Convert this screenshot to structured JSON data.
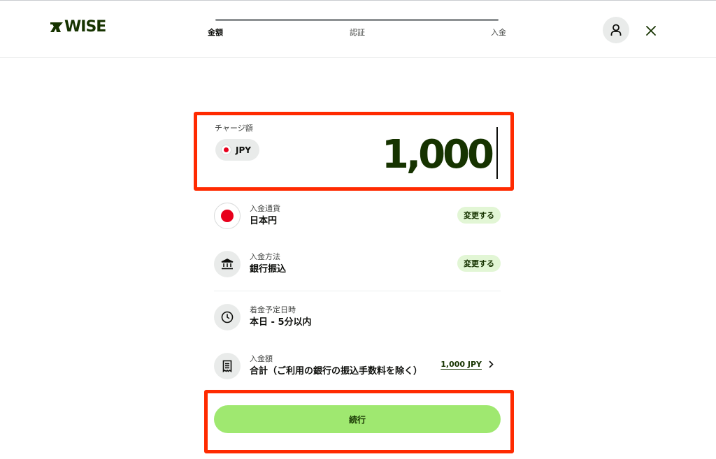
{
  "brand": {
    "logo_text": "WISE",
    "color": "#163300"
  },
  "stepper": {
    "steps": [
      {
        "label": "金額"
      },
      {
        "label": "認証"
      },
      {
        "label": "入金"
      }
    ]
  },
  "header": {
    "account_icon": "person-icon",
    "close_icon": "close-icon"
  },
  "amount": {
    "label": "チャージ額",
    "currency_code": "JPY",
    "value": "1,000"
  },
  "details": {
    "currency": {
      "label": "入金通貨",
      "value": "日本円",
      "action": "変更する",
      "icon": "japan-flag-icon"
    },
    "method": {
      "label": "入金方法",
      "value": "銀行振込",
      "action": "変更する",
      "icon": "bank-icon"
    },
    "arrival": {
      "label": "着金予定日時",
      "value": "本日 - 5分以内",
      "icon": "clock-icon"
    },
    "total": {
      "label": "入金額",
      "value": "合計（ご利用の銀行の振込手数料を除く）",
      "amount": "1,000 JPY",
      "icon": "receipt-icon"
    }
  },
  "continue_label": "続行",
  "colors": {
    "accent": "#9fe870",
    "accent_soft": "#e2f6d5",
    "highlight": "#ff2a00"
  }
}
